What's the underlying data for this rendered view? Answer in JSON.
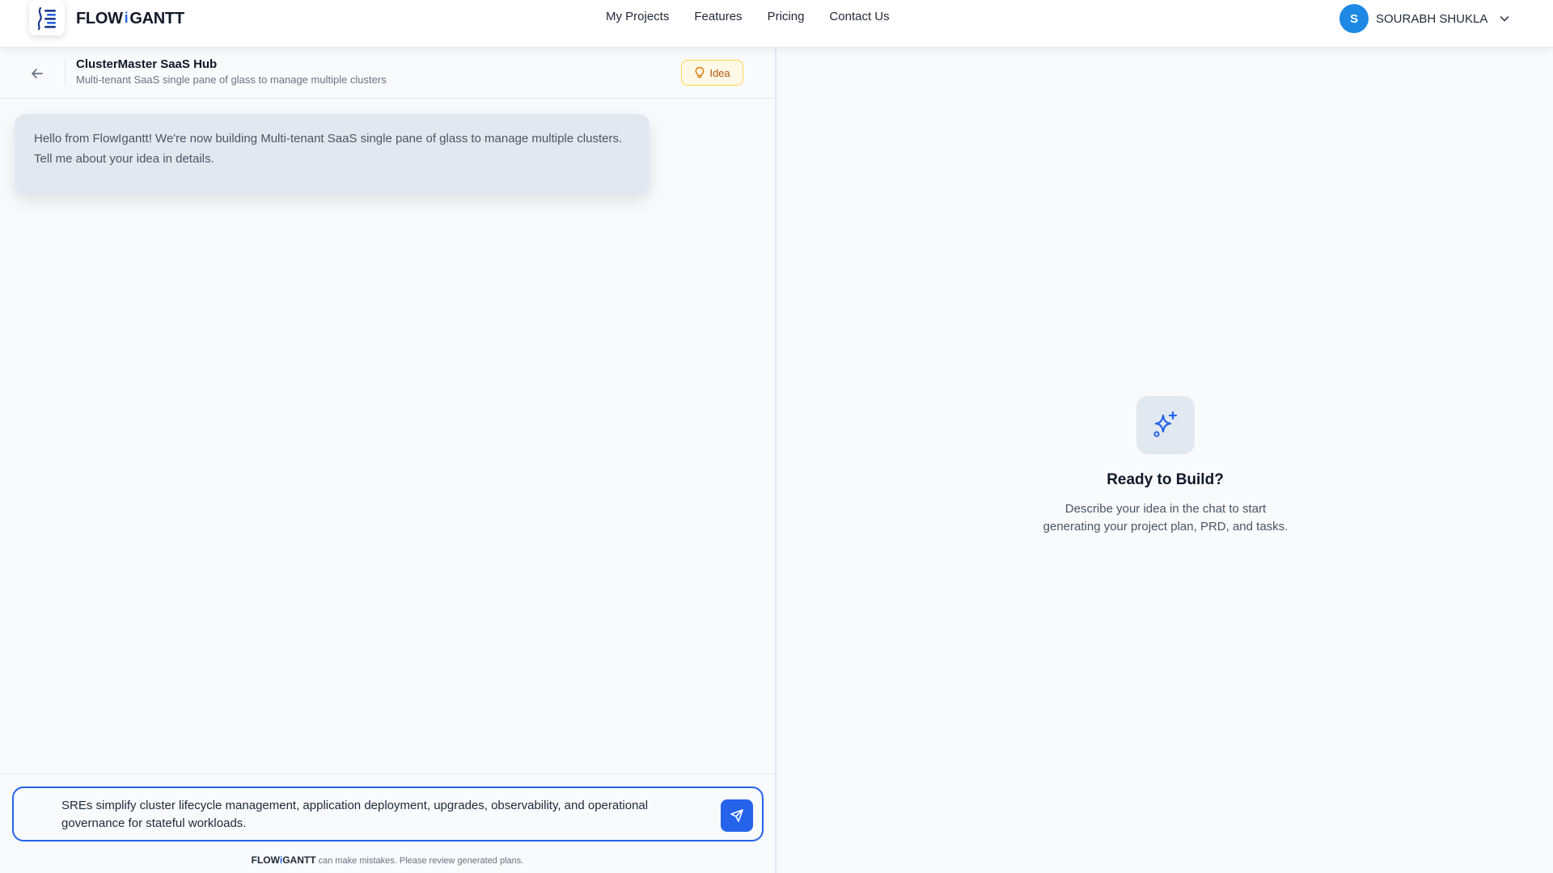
{
  "navbar": {
    "brand_left": "FLOW",
    "brand_mid": "i",
    "brand_right": "GANTT",
    "links": [
      "My Projects",
      "Features",
      "Pricing",
      "Contact Us"
    ],
    "user": {
      "initial": "S",
      "name": "SOURABH SHUKLA"
    }
  },
  "project": {
    "title": "ClusterMaster SaaS Hub",
    "subtitle": "Multi-tenant SaaS single pane of glass to manage multiple clusters",
    "badge": "Idea"
  },
  "chat": {
    "messages": [
      {
        "role": "assistant",
        "text": "Hello from FlowIgantt! We're now building Multi-tenant SaaS single pane of glass to manage multiple clusters. Tell me about your idea in details."
      }
    ]
  },
  "composer": {
    "value": "SREs simplify cluster lifecycle management, application deployment, upgrades, observability, and operational governance for stateful workloads."
  },
  "disclaimer": {
    "brand_left": "FLOW",
    "brand_mid": "i",
    "brand_right": "GANTT",
    "text": "can make mistakes. Please review generated plans."
  },
  "empty_state": {
    "title": "Ready to Build?",
    "description": "Describe your idea in the chat to start generating your project plan, PRD, and tasks."
  },
  "colors": {
    "accent": "#2563eb",
    "avatar": "#1e88e5",
    "badge_bg": "#fef9e7",
    "badge_text": "#b45309"
  },
  "icons": [
    "logo-icon",
    "chevron-down-icon",
    "arrow-left-icon",
    "lightbulb-icon",
    "send-icon",
    "sparkles-icon"
  ]
}
